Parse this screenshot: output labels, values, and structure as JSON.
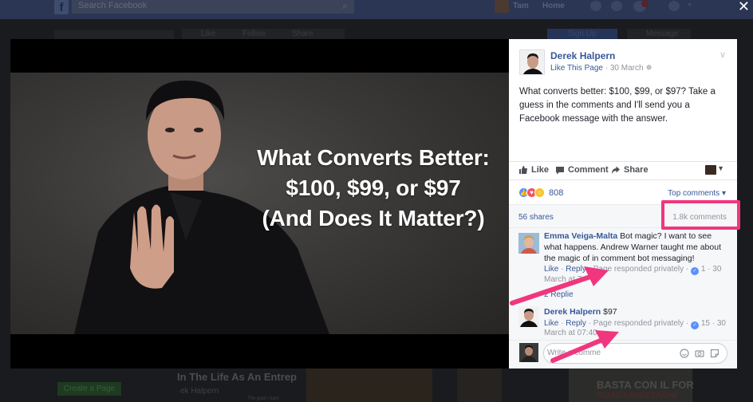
{
  "facebook_bar": {
    "search_placeholder": "Search Facebook",
    "user_name": "Tam",
    "home_label": "Home"
  },
  "background_page": {
    "like_label": "Like",
    "follow_label": "Follow",
    "share_label": "Share",
    "sign_up_label": "Sign Up",
    "message_label": "Message",
    "create_page_label": "Create a Page",
    "video_title": "In The Life As An Entrep",
    "video_author": "ek Halpern",
    "small_caption": "The goal i bam",
    "ad_text": "BASTA CON IL FOR",
    "ad_text_2": "GUADAGNISTAGNI"
  },
  "video": {
    "title_lines": [
      "What Converts Better:",
      "$100, $99, or $97",
      "(And Does It Matter?)"
    ]
  },
  "post": {
    "author": "Derek Halpern",
    "like_page": "Like This Page",
    "date": "30 March",
    "text": "What converts better: $100, $99, or $97? Take a guess in the comments and I'll send you a Facebook message with the answer.",
    "actions": {
      "like": "Like",
      "comment": "Comment",
      "share": "Share"
    },
    "reaction_count": "808",
    "top_comments": "Top comments",
    "shares": "56 shares",
    "comment_count": "1.8k comments"
  },
  "comments": [
    {
      "name": "Emma Veiga-Malta",
      "text": "Bot magic? I want to see what happens. Andrew Warner taught me about the magic of in comment bot messaging!",
      "like": "Like",
      "reply": "Reply",
      "responded": "Page responded privately",
      "likes": "1",
      "time_a": "30",
      "time_b": "March at 7"
    },
    {
      "name": "Derek Halpern",
      "text": "$97",
      "like": "Like",
      "reply": "Reply",
      "responded": "Page responded privately",
      "likes": "15",
      "time_a": "30",
      "time_b": "March at 07:40"
    }
  ],
  "replies_label": "2 Replie",
  "write_comment_placeholder": "Write a comme",
  "colors": {
    "facebook_blue": "#365899",
    "highlight_pink": "#f0367e",
    "like_blue": "#5890ff"
  }
}
